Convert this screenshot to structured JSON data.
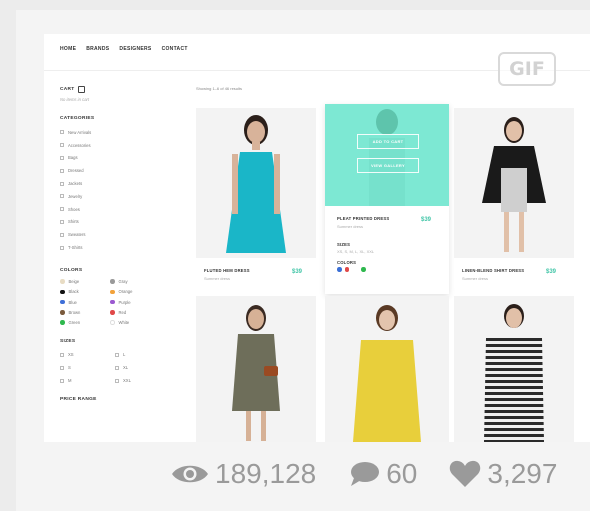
{
  "nav": [
    "HOME",
    "BRANDS",
    "DESIGNERS",
    "CONTACT"
  ],
  "badge": "GIF",
  "sidebar": {
    "cart_title": "CART",
    "cart_empty": "No items in cart",
    "categories_title": "CATEGORIES",
    "categories": [
      "New Arrivals",
      "Accessories",
      "Bags",
      "Dressed",
      "Jackets",
      "Jewelry",
      "Shoes",
      "Shirts",
      "Sweaters",
      "T-Shirts"
    ],
    "colors_title": "COLORS",
    "colors": [
      {
        "label": "Beige",
        "color": "#e8dcc4"
      },
      {
        "label": "Gray",
        "color": "#9a9a9a"
      },
      {
        "label": "Black",
        "color": "#111111"
      },
      {
        "label": "Orange",
        "color": "#f2a23a"
      },
      {
        "label": "Blue",
        "color": "#3f6fd8"
      },
      {
        "label": "Purple",
        "color": "#9b59d0"
      },
      {
        "label": "Brown",
        "color": "#7a5a3c"
      },
      {
        "label": "Red",
        "color": "#e04848"
      },
      {
        "label": "Green",
        "color": "#2fb84e"
      },
      {
        "label": "White",
        "color": "#ffffff"
      }
    ],
    "sizes_title": "SIZES",
    "sizes": [
      "XS",
      "L",
      "S",
      "XL",
      "M",
      "XXL"
    ],
    "price_title": "PRICE RANGE"
  },
  "showing": "Showing 1–6 of 46 results",
  "products": [
    {
      "name": "FLUTED HEM DRESS",
      "sub": "Summer dress",
      "price": "$39",
      "garment": "#1ab6c8"
    },
    {
      "name": "PLEAT PRINTED DRESS",
      "sub": "Summer dress",
      "price": "$39",
      "sizes_label": "SIZES",
      "sizes_value": "XS, S, M, L, XL, XXL",
      "colors_label": "COLORS",
      "swatches": [
        "#3a6fd6",
        "#e04848",
        "#2fb84e"
      ],
      "btn_cart": "ADD TO CART",
      "btn_gallery": "VIEW GALLERY",
      "overlay_color": "#5fe8cd"
    },
    {
      "name": "LINEN-BLEND SHIRT DRESS",
      "sub": "Summer dress",
      "price": "$39",
      "garment": "#1a1a1a"
    },
    {
      "name": "",
      "sub": "",
      "price": "",
      "garment": "#6e6e5a"
    },
    {
      "name": "",
      "sub": "",
      "price": "",
      "garment": "#e8cf3b"
    },
    {
      "name": "",
      "sub": "",
      "price": "",
      "garment": "#d9d9d9"
    }
  ],
  "stats": {
    "views": "189,128",
    "comments": "60",
    "likes": "3,297"
  }
}
